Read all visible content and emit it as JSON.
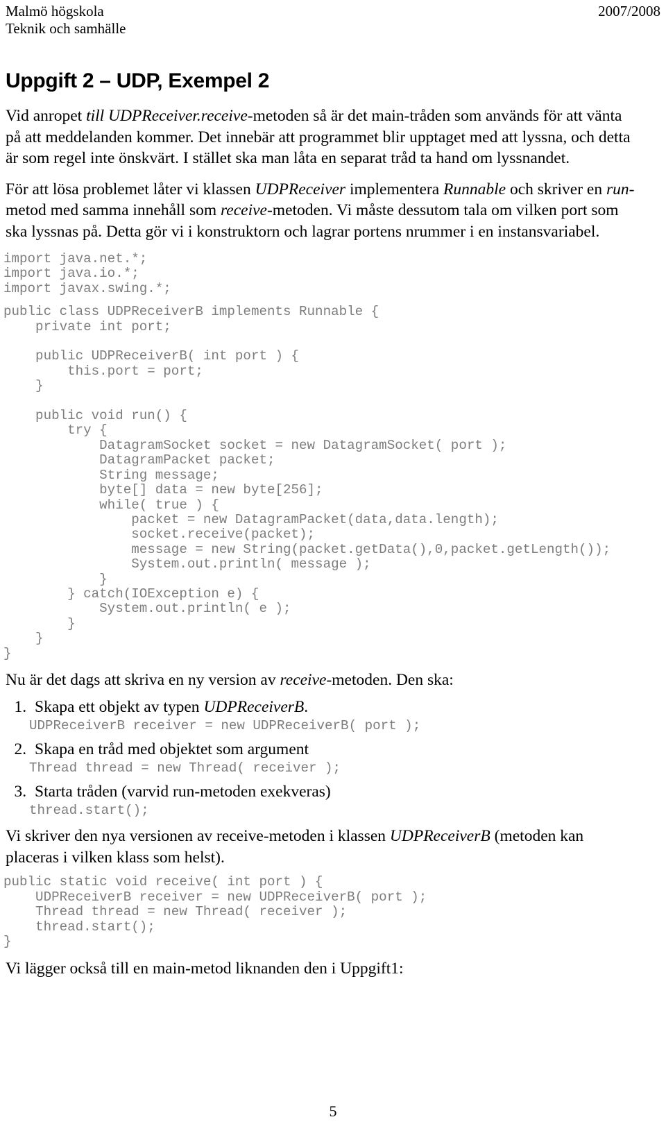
{
  "header": {
    "institution": "Malmö högskola",
    "department": "Teknik och samhälle",
    "academic_year": "2007/2008"
  },
  "title": "Uppgift 2 – UDP, Exempel 2",
  "paragraphs": {
    "intro_p1_a": "Vid anropet ",
    "intro_p1_b": "till UDPReceiver.receive",
    "intro_p1_c": "-metoden så är det main-tråden som används för att vänta på att meddelanden kommer. Det innebär att programmet blir upptaget med att lyssna, och detta är som regel inte önskvärt. I stället ska man låta en separat tråd ta hand om lyssnandet.",
    "intro_p2_a": "För att lösa problemet låter vi klassen ",
    "intro_p2_b": "UDPReceiver",
    "intro_p2_c": " implementera ",
    "intro_p2_d": "Runnable",
    "intro_p2_e": " och skriver en ",
    "intro_p2_f": "run",
    "intro_p2_g": "-metod med samma innehåll som ",
    "intro_p2_h": "receive",
    "intro_p2_i": "-metoden. Vi måste dessutom tala om vilken port som ska lyssnas på. Detta gör vi i konstruktorn och lagrar portens nrummer i en instansvariabel.",
    "after_class_a": "Nu är det dags att skriva en ny version av ",
    "after_class_b": "receive",
    "after_class_c": "-metoden. Den ska:",
    "before_receive_a": "Vi skriver den nya versionen av receive-metoden i klassen ",
    "before_receive_b": "UDPReceiverB",
    "before_receive_c": " (metoden kan placeras i vilken klass som helst).",
    "closing": "Vi lägger också till en main-metod liknanden den i Uppgift1:"
  },
  "code_blocks": {
    "imports": "import java.net.*;\nimport java.io.*;\nimport javax.swing.*;",
    "class_body": "public class UDPReceiverB implements Runnable {\n    private int port;\n\n    public UDPReceiverB( int port ) {\n        this.port = port;\n    }\n\n    public void run() {\n        try {\n            DatagramSocket socket = new DatagramSocket( port );\n            DatagramPacket packet;\n            String message;\n            byte[] data = new byte[256];\n            while( true ) {\n                packet = new DatagramPacket(data,data.length);\n                socket.receive(packet);\n                message = new String(packet.getData(),0,packet.getLength());\n                System.out.println( message );\n            }\n        } catch(IOException e) {\n            System.out.println( e );\n        }\n    }\n}",
    "receive_method": "public static void receive( int port ) {\n    UDPReceiverB receiver = new UDPReceiverB( port );\n    Thread thread = new Thread( receiver );\n    thread.start();\n}"
  },
  "steps": [
    {
      "text_a": "Skapa ett objekt av typen ",
      "text_b": "UDPReceiverB",
      "text_c": ".",
      "code": "UDPReceiverB receiver = new UDPReceiverB( port );"
    },
    {
      "text_a": "Skapa en tråd med objektet som argument",
      "text_b": "",
      "text_c": "",
      "code": "Thread thread = new Thread( receiver );"
    },
    {
      "text_a": "Starta tråden (varvid run-metoden exekveras)",
      "text_b": "",
      "text_c": "",
      "code": "thread.start();"
    }
  ],
  "page_number": "5"
}
